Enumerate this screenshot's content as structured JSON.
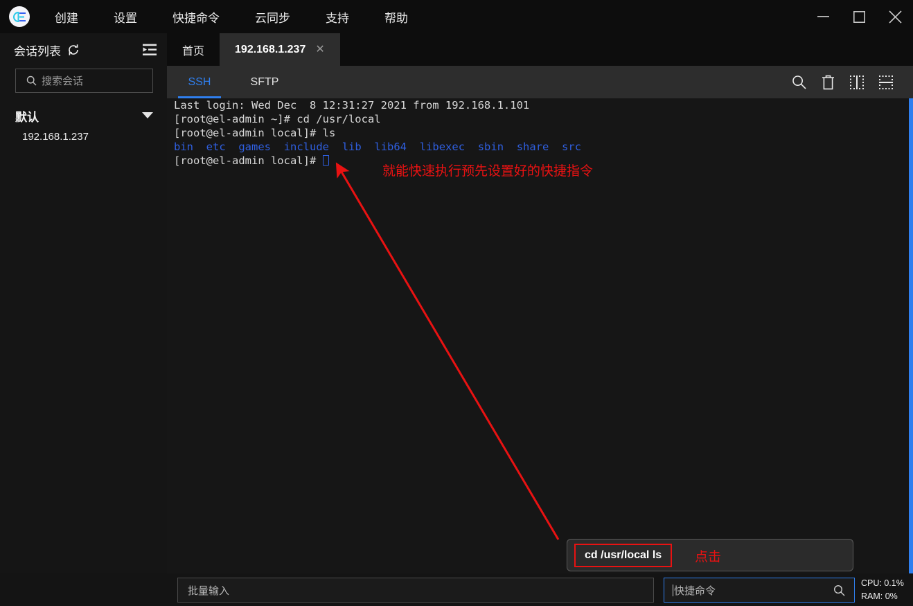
{
  "window": {
    "controls": [
      {
        "name": "minimize",
        "glyph": "minimize-icon"
      },
      {
        "name": "maximize",
        "glyph": "maximize-icon"
      },
      {
        "name": "close",
        "glyph": "close-icon"
      }
    ]
  },
  "menu": {
    "logo_label": "logo",
    "items": [
      {
        "label": "创建"
      },
      {
        "label": "设置"
      },
      {
        "label": "快捷命令"
      },
      {
        "label": "云同步"
      },
      {
        "label": "支持"
      },
      {
        "label": "帮助"
      }
    ]
  },
  "sidebar": {
    "title": "会话列表",
    "refresh_icon": "refresh-icon",
    "collapse_icon": "collapse-panel-icon",
    "search": {
      "icon": "search-icon",
      "placeholder": "搜索会话",
      "value": ""
    },
    "group": {
      "label": "默认",
      "caret_icon": "chevron-down-icon",
      "expanded": true
    },
    "sessions": [
      {
        "label": "192.168.1.237"
      }
    ]
  },
  "tabs": [
    {
      "label": "首页",
      "active": false,
      "closable": false
    },
    {
      "label": "192.168.1.237",
      "active": true,
      "closable": true,
      "close_glyph": "✕"
    }
  ],
  "toolbar": {
    "protocol_tabs": [
      {
        "label": "SSH",
        "active": true
      },
      {
        "label": "SFTP",
        "active": false
      }
    ],
    "icons": [
      {
        "name": "search-icon"
      },
      {
        "name": "trash-icon"
      },
      {
        "name": "split-vertical-icon"
      },
      {
        "name": "split-horizontal-icon"
      }
    ]
  },
  "terminal": {
    "lines": [
      [
        {
          "t": "Last login: Wed Dec  8 12:31:27 2021 from 192.168.1.101",
          "c": "fg"
        }
      ],
      [
        {
          "t": "[root@el-admin ~]# cd /usr/local",
          "c": "fg"
        }
      ],
      [
        {
          "t": "[root@el-admin local]# ls",
          "c": "fg"
        }
      ],
      [
        {
          "t": "bin",
          "c": "dir"
        },
        {
          "t": "  ",
          "c": "fg"
        },
        {
          "t": "etc",
          "c": "dir"
        },
        {
          "t": "  ",
          "c": "fg"
        },
        {
          "t": "games",
          "c": "dir"
        },
        {
          "t": "  ",
          "c": "fg"
        },
        {
          "t": "include",
          "c": "dir"
        },
        {
          "t": "  ",
          "c": "fg"
        },
        {
          "t": "lib",
          "c": "dir"
        },
        {
          "t": "  ",
          "c": "fg"
        },
        {
          "t": "lib64",
          "c": "dir"
        },
        {
          "t": "  ",
          "c": "fg"
        },
        {
          "t": "libexec",
          "c": "dir"
        },
        {
          "t": "  ",
          "c": "fg"
        },
        {
          "t": "sbin",
          "c": "dir"
        },
        {
          "t": "  ",
          "c": "fg"
        },
        {
          "t": "share",
          "c": "dir"
        },
        {
          "t": "  ",
          "c": "fg"
        },
        {
          "t": "src",
          "c": "dir"
        }
      ],
      [
        {
          "t": "[root@el-admin local]# ",
          "c": "fg"
        },
        {
          "t": "",
          "c": "cursor"
        }
      ]
    ]
  },
  "annotations": {
    "text_top": "就能快速执行预先设置好的快捷指令",
    "text_click": "点击",
    "color": "#e81212"
  },
  "quick_popup": {
    "items": [
      {
        "label": "cd /usr/local ls",
        "highlighted": true
      }
    ]
  },
  "bottom": {
    "batch_input": {
      "placeholder": "批量输入",
      "value": ""
    },
    "quick_input": {
      "placeholder": "快捷命令",
      "value": "",
      "focused": true,
      "search_icon": "search-icon"
    },
    "stats": {
      "cpu": "CPU: 0.1%",
      "ram": "RAM: 0%"
    }
  },
  "colors": {
    "accent": "#2f7fef",
    "annotation": "#e81212",
    "terminal_dir": "#2f5fe0",
    "terminal_fg": "#d8d8d8"
  }
}
